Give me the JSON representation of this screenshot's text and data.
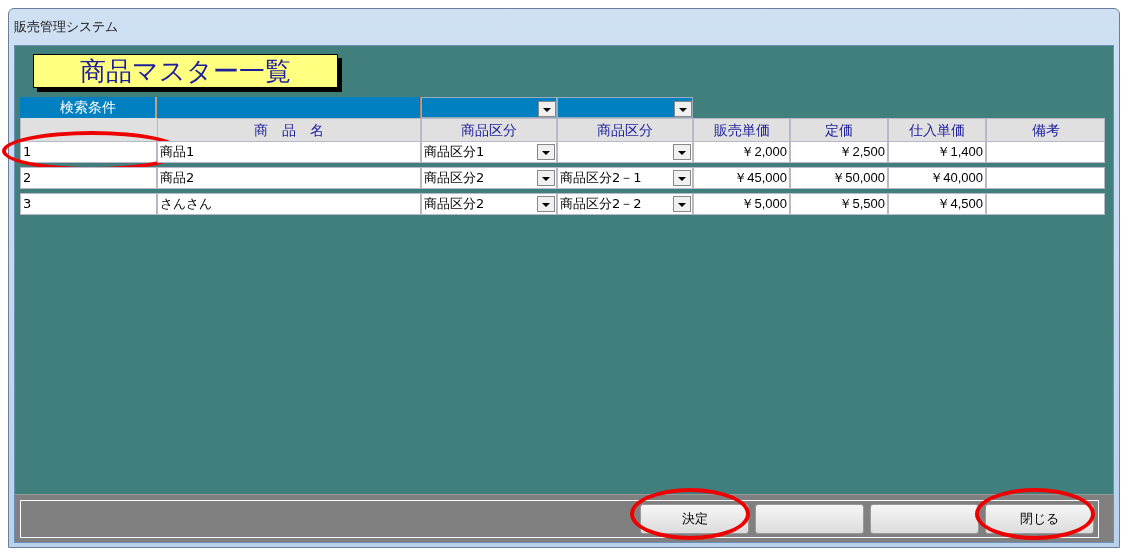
{
  "window": {
    "title": "販売管理システム"
  },
  "heading": "商品マスター一覧",
  "search": {
    "label": "検索条件",
    "fields": [
      {
        "kind": "text"
      },
      {
        "kind": "dropdown"
      },
      {
        "kind": "dropdown"
      }
    ]
  },
  "table": {
    "columns": [
      "商　品　名",
      "商品区分",
      "商品区分",
      "販売単価",
      "定価",
      "仕入単価",
      "備考"
    ],
    "rows": [
      {
        "no": "1",
        "name": "商品1",
        "category": "商品区分1",
        "price": "￥2,000",
        "list_price": "￥2,500",
        "cost": "￥1,400",
        "highlighted": true
      },
      {
        "no": "2",
        "name": "商品2",
        "category": "商品区分2",
        "subcategory": "商品区分2－1",
        "price": "￥45,000",
        "list_price": "￥50,000",
        "cost": "￥40,000",
        "highlighted": false
      },
      {
        "no": "3",
        "name": "さんさん",
        "category": "商品区分2",
        "subcategory": "商品区分2－2",
        "price": "￥5,000",
        "list_price": "￥5,500",
        "cost": "￥4,500",
        "highlighted": false
      }
    ]
  },
  "buttons": [
    {
      "kind": "text",
      "label": "決定",
      "highlighted": true
    },
    {
      "kind": "blank",
      "highlighted": false
    },
    {
      "kind": "blank",
      "highlighted": false
    },
    {
      "kind": "text",
      "label": "閉じる",
      "highlighted": true
    }
  ]
}
